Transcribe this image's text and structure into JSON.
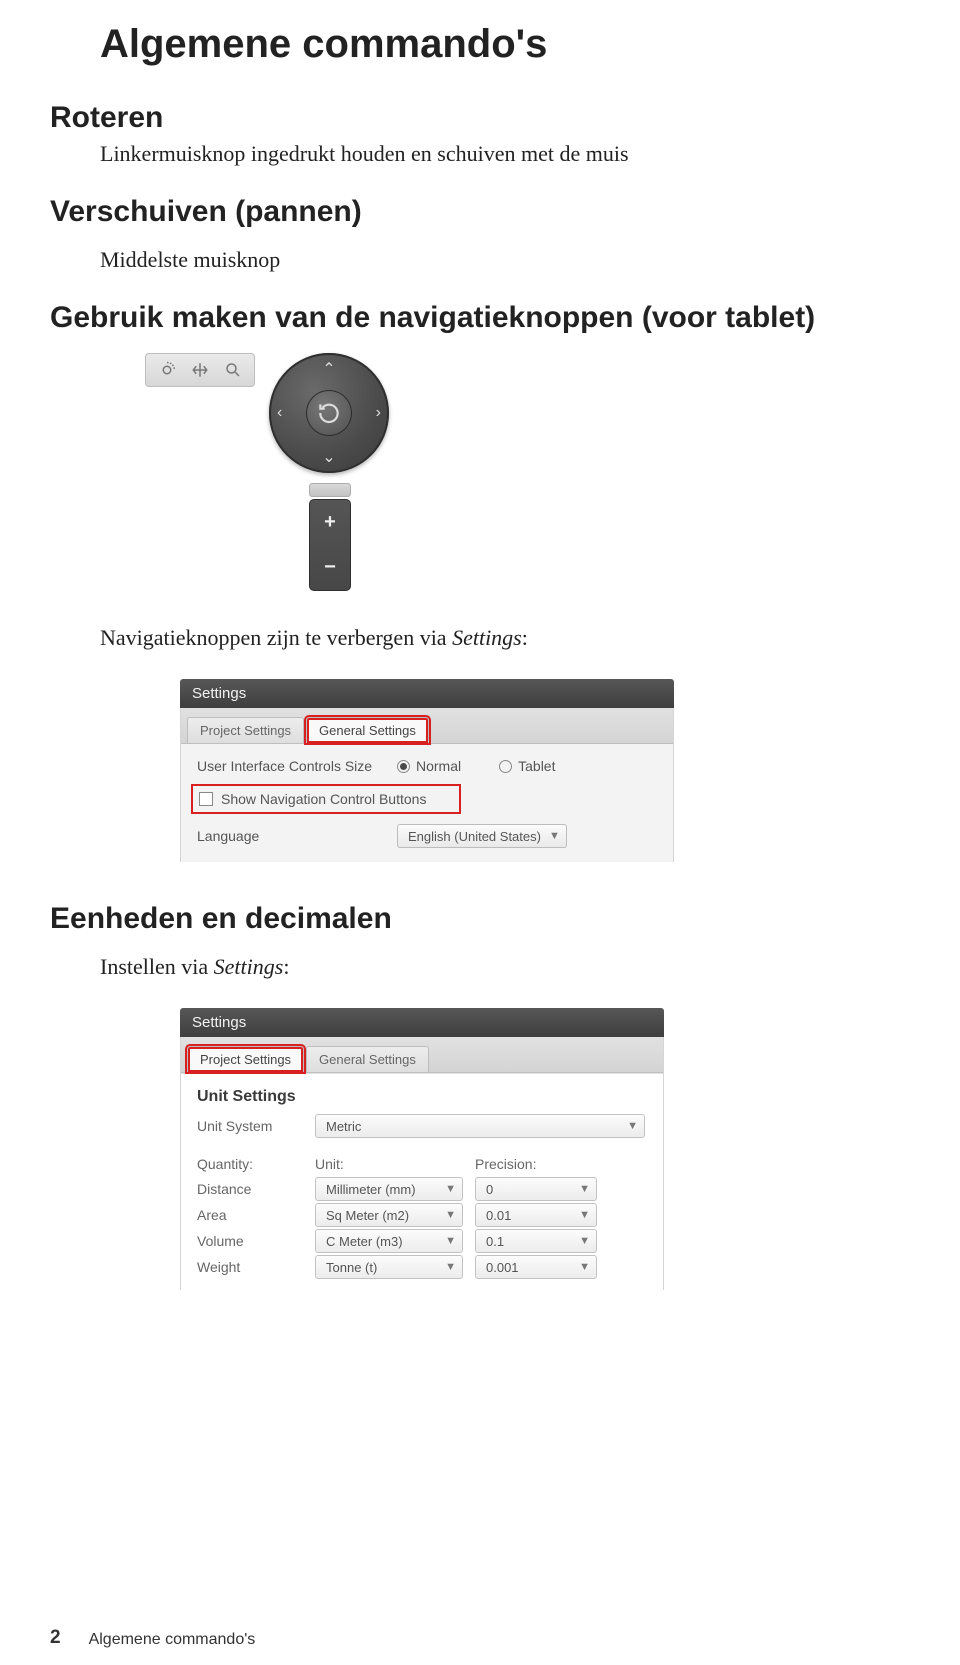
{
  "page_title": "Algemene commando's",
  "sections": {
    "roteren": {
      "heading": "Roteren",
      "text": "Linkermuisknop ingedrukt houden en schuiven met de muis"
    },
    "verschuiven": {
      "heading": "Verschuiven (pannen)",
      "text": "Middelste muisknop"
    },
    "navknoppen": {
      "heading": "Gebruik maken van de navigatieknoppen (voor tablet)",
      "hide_text_prefix": "Navigatieknoppen zijn te verbergen via ",
      "hide_text_italic": "Settings",
      "plus": "+",
      "minus": "−"
    },
    "eenheden": {
      "heading": "Eenheden en decimalen",
      "text_prefix": "Instellen via ",
      "text_italic": "Settings"
    }
  },
  "settings_panel_1": {
    "title": "Settings",
    "tabs": {
      "project": "Project Settings",
      "general": "General Settings"
    },
    "ui_size_label": "User Interface Controls Size",
    "ui_size_normal": "Normal",
    "ui_size_tablet": "Tablet",
    "show_nav_label": "Show Navigation Control Buttons",
    "language_label": "Language",
    "language_value": "English (United States)"
  },
  "settings_panel_2": {
    "title": "Settings",
    "tabs": {
      "project": "Project Settings",
      "general": "General Settings"
    },
    "section_title": "Unit Settings",
    "unit_system_label": "Unit System",
    "unit_system_value": "Metric",
    "col_quantity": "Quantity:",
    "col_unit": "Unit:",
    "col_precision": "Precision:",
    "rows": {
      "distance": {
        "label": "Distance",
        "unit": "Millimeter (mm)",
        "precision": "0"
      },
      "area": {
        "label": "Area",
        "unit": "Sq Meter (m2)",
        "precision": "0.01"
      },
      "volume": {
        "label": "Volume",
        "unit": "C Meter (m3)",
        "precision": "0.1"
      },
      "weight": {
        "label": "Weight",
        "unit": "Tonne (t)",
        "precision": "0.001"
      }
    }
  },
  "footer": {
    "page_number": "2",
    "text": "Algemene commando's"
  }
}
